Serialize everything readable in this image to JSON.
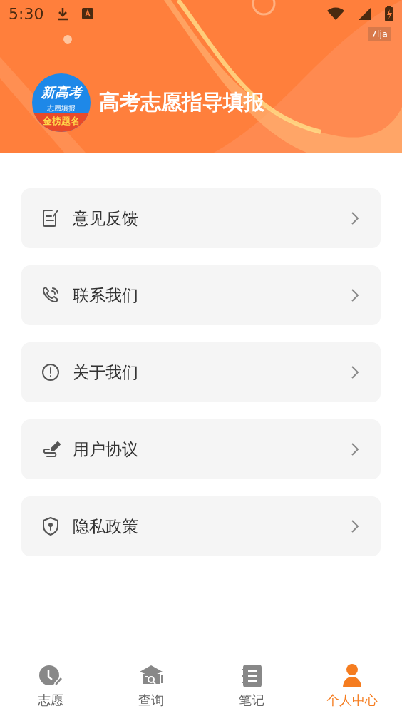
{
  "status_bar": {
    "time": "5:30",
    "tag": "7lja"
  },
  "header": {
    "logo": {
      "top": "新高考",
      "middle": "志愿填报",
      "bottom": "金榜题名"
    },
    "title": "高考志愿指导填报"
  },
  "menu": [
    {
      "label": "意见反馈"
    },
    {
      "label": "联系我们"
    },
    {
      "label": "关于我们"
    },
    {
      "label": "用户协议"
    },
    {
      "label": "隐私政策"
    }
  ],
  "tab_bar": [
    {
      "label": "志愿",
      "selected": false
    },
    {
      "label": "查询",
      "selected": false
    },
    {
      "label": "笔记",
      "selected": false
    },
    {
      "label": "个人中心",
      "selected": true
    }
  ]
}
